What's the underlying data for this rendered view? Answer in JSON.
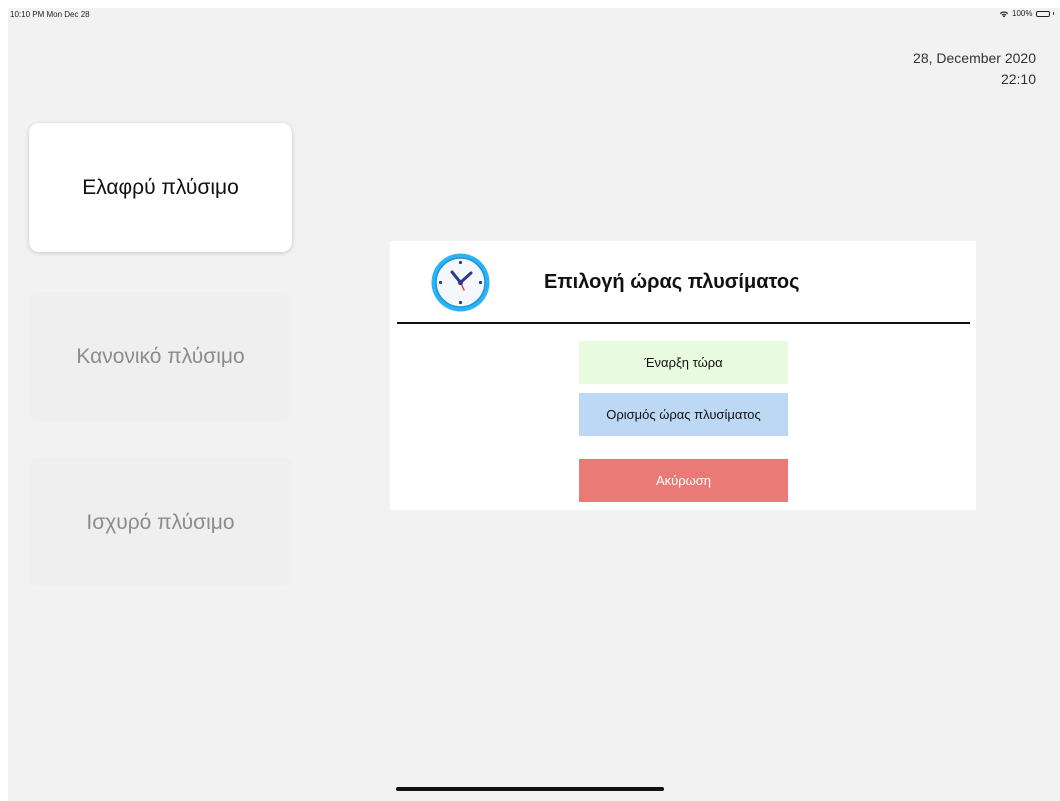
{
  "status_bar": {
    "time_date": "10:10 PM  Mon Dec 28",
    "battery": "100%"
  },
  "header": {
    "date": "28, December 2020",
    "time": "22:10"
  },
  "wash_modes": [
    {
      "label": "Ελαφρύ πλύσιμο",
      "state": "selected"
    },
    {
      "label": "Κανονικό πλύσιμο",
      "state": "disabled"
    },
    {
      "label": "Ισχυρό πλύσιμο",
      "state": "disabled"
    }
  ],
  "dialog": {
    "icon": "clock-icon",
    "title": "Επιλογή ώρας πλυσίματος",
    "start_now_label": "Έναρξη τώρα",
    "set_time_label": "Ορισμός ώρας πλυσίματος",
    "cancel_label": "Ακύρωση"
  },
  "colors": {
    "background": "#f2f2f2",
    "start_now": "#e9fbdf",
    "set_time": "#bcd8f4",
    "cancel": "#ea7a76",
    "clock_accent": "#2ab3f5",
    "clock_hands": "#2f3a8f"
  }
}
